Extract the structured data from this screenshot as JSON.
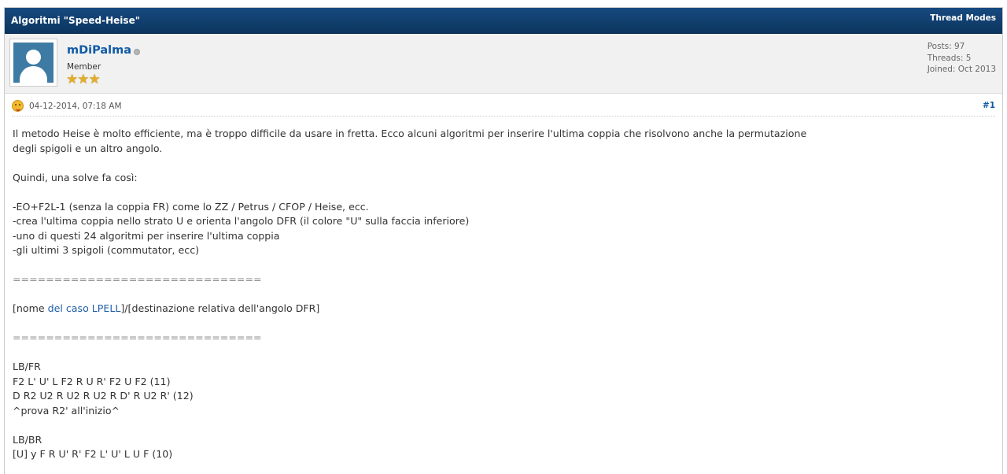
{
  "thread": {
    "title": "Algoritmi \"Speed-Heise\"",
    "thread_modes_label": "Thread Modes"
  },
  "author": {
    "username": "mDiPalma",
    "title": "Member",
    "stars": "★★★",
    "stats": {
      "posts": "Posts: 97",
      "threads": "Threads: 5",
      "joined": "Joined: Oct 2013"
    }
  },
  "post": {
    "date": "04-12-2014, 07:18 AM",
    "number": "#1",
    "lines": {
      "l1": "Il metodo Heise è molto efficiente, ma è troppo difficile da usare in fretta. Ecco alcuni algoritmi per inserire l'ultima coppia che risolvono anche la permutazione",
      "l2": "degli spigoli e un altro angolo.",
      "l3": "Quindi, una solve fa così:",
      "l4": "-EO+F2L-1 (senza la coppia FR) come lo ZZ / Petrus / CFOP / Heise, ecc.",
      "l5": "-crea l'ultima coppia nello strato U e orienta l'angolo DFR (il colore \"U\" sulla faccia inferiore)",
      "l6": "-uno di questi 24 algoritmi per inserire l'ultima coppia",
      "l7": "-gli ultimi 3 spigoli (commutator, ecc)",
      "sep1": "==============================",
      "case_pre": "[nome ",
      "case_link": "del caso LPELL",
      "case_post": "]/[destinazione relativa dell'angolo DFR]",
      "sep2": "==============================",
      "lbfr": "LB/FR",
      "alg1": "F2 L' U' L F2 R U R' F2 U F2 (11)",
      "alg2": "D R2 U2 R U2 R U2 R D' R U2 R' (12)",
      "hint": "^prova R2' all'inizio^",
      "lbbr": "LB/BR",
      "alg3": "[U] y F R U' R' F2 L' U' L U F (10)"
    }
  },
  "colors": {
    "header_bg": "#0f3c6b",
    "link": "#0f5aa6",
    "star": "#e2ad2a"
  }
}
